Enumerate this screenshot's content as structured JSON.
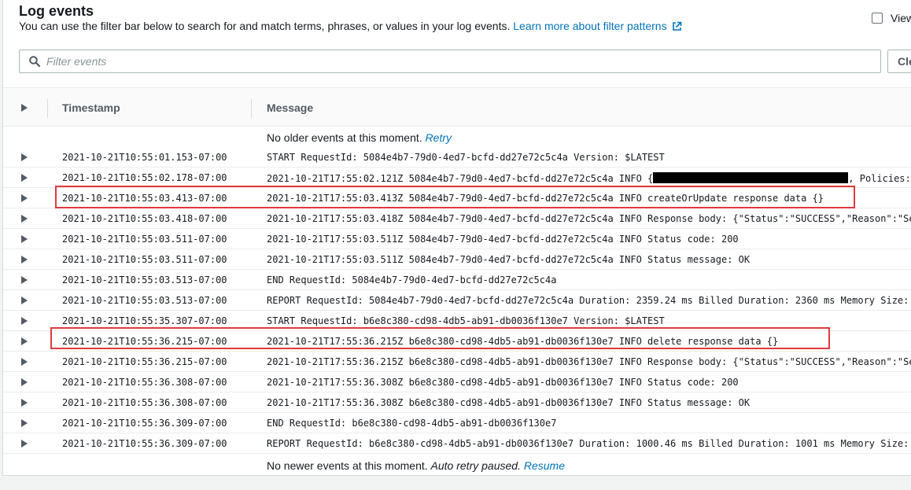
{
  "header": {
    "title": "Log events",
    "description": "You can use the filter bar below to search for and match terms, phrases, or values in your log events.",
    "learn_more": "Learn more about filter patterns",
    "view_label": "View"
  },
  "filter": {
    "placeholder": "Filter events",
    "value": "",
    "clear_label": "Clear"
  },
  "columns": {
    "timestamp": "Timestamp",
    "message": "Message"
  },
  "notices": {
    "older": "No older events at this moment.",
    "retry": "Retry",
    "newer": "No newer events at this moment.",
    "paused": "Auto retry paused.",
    "resume": "Resume"
  },
  "rows": [
    {
      "ts": "2021-10-21T10:55:01.153-07:00",
      "msg": "START RequestId: 5084e4b7-79d0-4ed7-bcfd-dd27e72c5c4a Version: $LATEST"
    },
    {
      "ts": "2021-10-21T10:55:02.178-07:00",
      "msg": "2021-10-21T17:55:02.121Z 5084e4b7-79d0-4ed7-bcfd-dd27e72c5c4a INFO {",
      "msg_after": ", Policies:",
      "redacted": true
    },
    {
      "ts": "2021-10-21T10:55:03.413-07:00",
      "msg": "2021-10-21T17:55:03.413Z 5084e4b7-79d0-4ed7-bcfd-dd27e72c5c4a INFO createOrUpdate response data {}",
      "highlighted": true
    },
    {
      "ts": "2021-10-21T10:55:03.418-07:00",
      "msg": "2021-10-21T17:55:03.418Z 5084e4b7-79d0-4ed7-bcfd-dd27e72c5c4a INFO Response body: {\"Status\":\"SUCCESS\",\"Reason\":\"Se"
    },
    {
      "ts": "2021-10-21T10:55:03.511-07:00",
      "msg": "2021-10-21T17:55:03.511Z 5084e4b7-79d0-4ed7-bcfd-dd27e72c5c4a INFO Status code: 200"
    },
    {
      "ts": "2021-10-21T10:55:03.511-07:00",
      "msg": "2021-10-21T17:55:03.511Z 5084e4b7-79d0-4ed7-bcfd-dd27e72c5c4a INFO Status message: OK"
    },
    {
      "ts": "2021-10-21T10:55:03.513-07:00",
      "msg": "END RequestId: 5084e4b7-79d0-4ed7-bcfd-dd27e72c5c4a"
    },
    {
      "ts": "2021-10-21T10:55:03.513-07:00",
      "msg": "REPORT RequestId: 5084e4b7-79d0-4ed7-bcfd-dd27e72c5c4a Duration: 2359.24 ms Billed Duration: 2360 ms Memory Size:"
    },
    {
      "ts": "2021-10-21T10:55:35.307-07:00",
      "msg": "START RequestId: b6e8c380-cd98-4db5-ab91-db0036f130e7 Version: $LATEST"
    },
    {
      "ts": "2021-10-21T10:55:36.215-07:00",
      "msg": "2021-10-21T17:55:36.215Z b6e8c380-cd98-4db5-ab91-db0036f130e7 INFO delete response data {}",
      "highlighted": true
    },
    {
      "ts": "2021-10-21T10:55:36.215-07:00",
      "msg": "2021-10-21T17:55:36.215Z b6e8c380-cd98-4db5-ab91-db0036f130e7 INFO Response body: {\"Status\":\"SUCCESS\",\"Reason\":\"Se"
    },
    {
      "ts": "2021-10-21T10:55:36.308-07:00",
      "msg": "2021-10-21T17:55:36.308Z b6e8c380-cd98-4db5-ab91-db0036f130e7 INFO Status code: 200"
    },
    {
      "ts": "2021-10-21T10:55:36.308-07:00",
      "msg": "2021-10-21T17:55:36.308Z b6e8c380-cd98-4db5-ab91-db0036f130e7 INFO Status message: OK"
    },
    {
      "ts": "2021-10-21T10:55:36.309-07:00",
      "msg": "END RequestId: b6e8c380-cd98-4db5-ab91-db0036f130e7"
    },
    {
      "ts": "2021-10-21T10:55:36.309-07:00",
      "msg": "REPORT RequestId: b6e8c380-cd98-4db5-ab91-db0036f130e7 Duration: 1000.46 ms Billed Duration: 1001 ms Memory Size:"
    }
  ],
  "colors": {
    "link": "#0073bb",
    "highlight": "#e0393e",
    "text": "#16191f"
  },
  "icons": {
    "search": "search-icon",
    "external": "external-link-icon",
    "expand": "caret-right-icon"
  }
}
